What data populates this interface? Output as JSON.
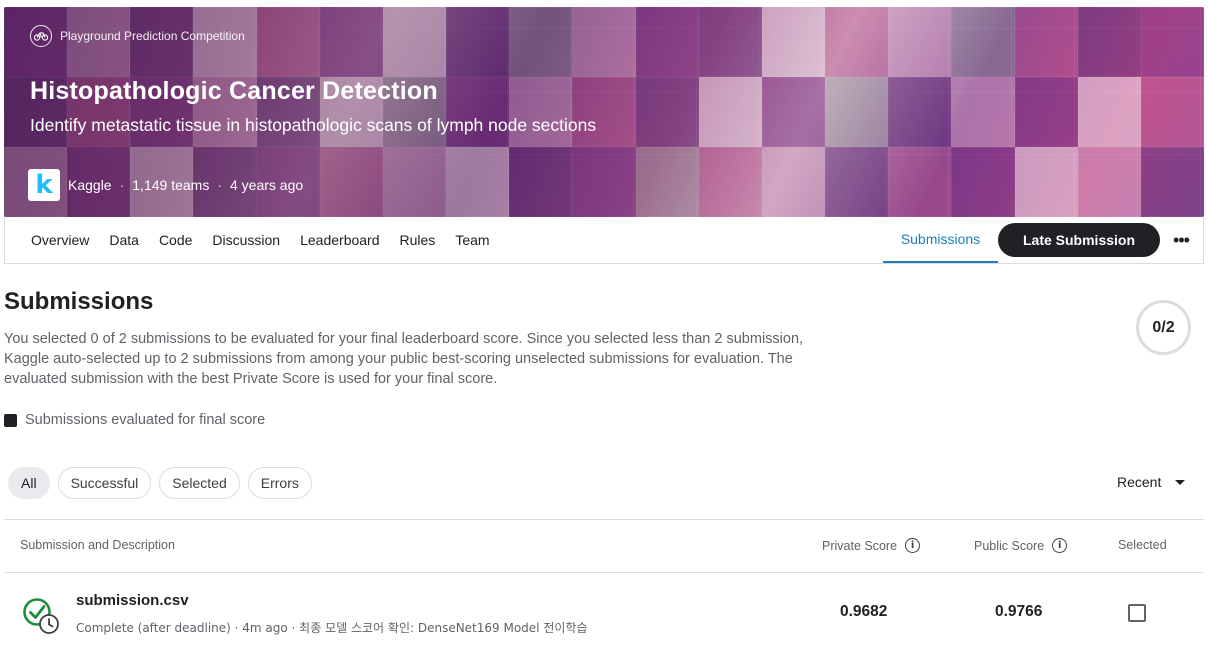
{
  "banner": {
    "competition_type": "Playground Prediction Competition",
    "title": "Histopathologic Cancer Detection",
    "subtitle": "Identify metastatic tissue in histopathologic scans of lymph node sections",
    "host": "Kaggle",
    "teams": "1,149 teams",
    "age": "4 years ago",
    "separator": "·",
    "logo_letter": "k"
  },
  "tabs": {
    "items": [
      "Overview",
      "Data",
      "Code",
      "Discussion",
      "Leaderboard",
      "Rules",
      "Team"
    ],
    "active": "Submissions",
    "late_submission": "Late Submission",
    "more": "•••"
  },
  "main": {
    "title": "Submissions",
    "description": "You selected 0 of 2 submissions to be evaluated for your final leaderboard score. Since you selected less than 2 submission, Kaggle auto-selected up to 2 submissions from among your public best-scoring unselected submissions for evaluation. The evaluated submission with the best Private Score is used for your final score.",
    "selected_count": "0/2",
    "legend": "Submissions evaluated for final score",
    "filters": [
      "All",
      "Successful",
      "Selected",
      "Errors"
    ],
    "active_filter": "All",
    "sort": "Recent"
  },
  "table": {
    "headers": {
      "submission": "Submission and Description",
      "private": "Private Score",
      "public": "Public Score",
      "selected": "Selected"
    },
    "rows": [
      {
        "name": "submission.csv",
        "meta": "Complete (after deadline) · 4m ago · 최종 모델 스코어 확인: DenseNet169 Model 전이학습",
        "private_score": "0.9682",
        "public_score": "0.9766",
        "selected": false
      }
    ]
  },
  "colors": {
    "accent": "#1f7fb6",
    "success": "#1e8e3e",
    "dark_button": "#202124",
    "kaggle_blue": "#20beff"
  }
}
